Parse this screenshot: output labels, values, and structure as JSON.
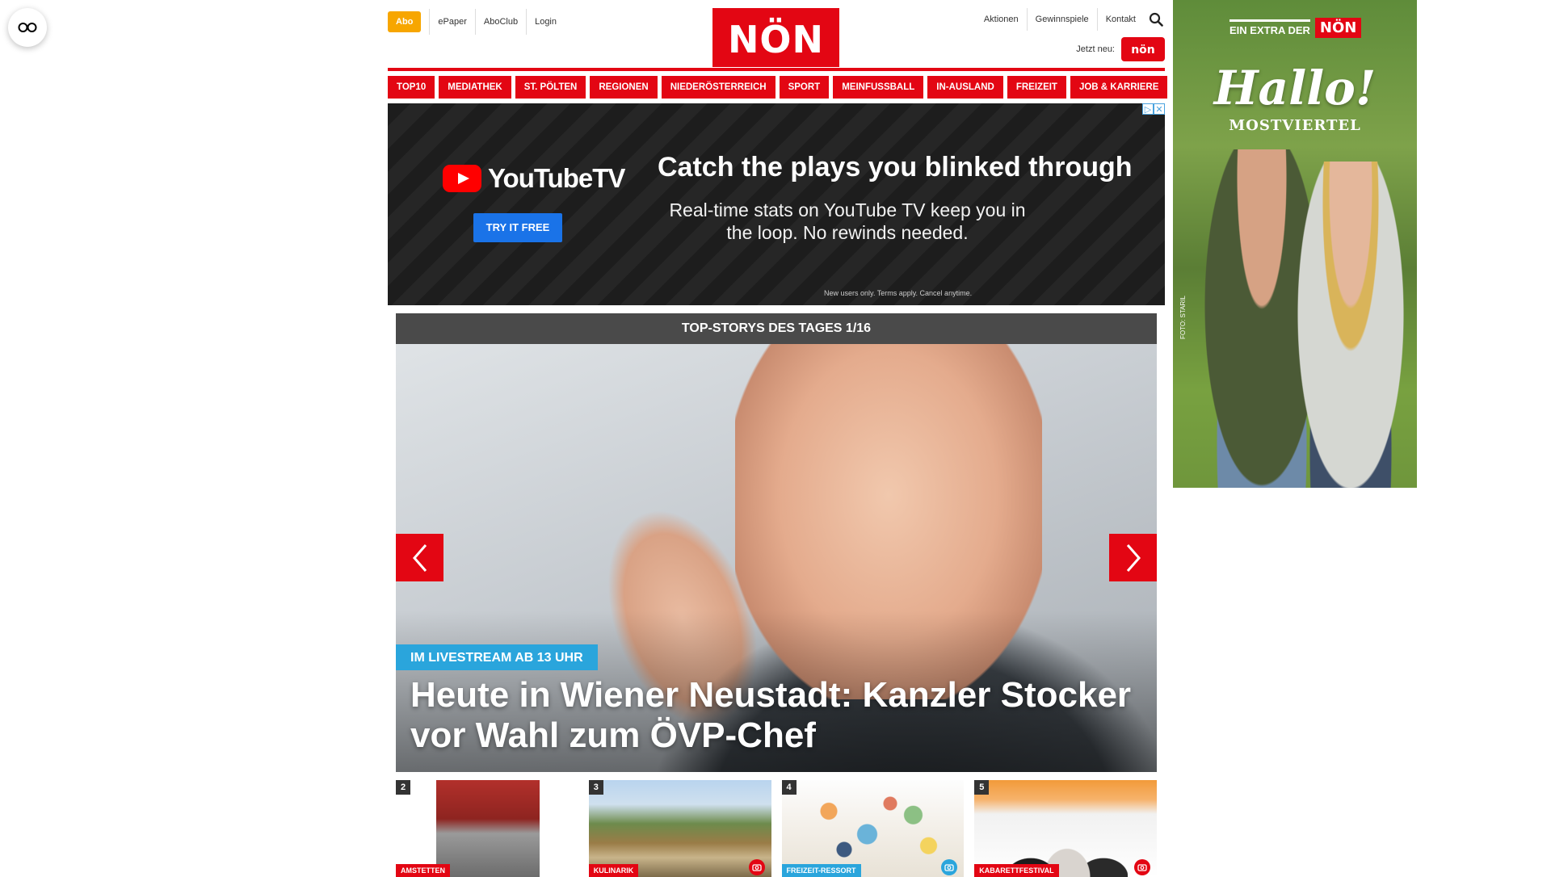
{
  "header": {
    "abo_label": "Abo",
    "links": [
      "ePaper",
      "AboClub",
      "Login"
    ],
    "logo_text": "NÖN",
    "right_links": [
      "Aktionen",
      "Gewinnspiele",
      "Kontakt"
    ],
    "jetzt_label": "Jetzt neu:",
    "jetzt_logo_text": "nön"
  },
  "nav": {
    "items": [
      "TOP10",
      "MEDIATHEK",
      "ST. PÖLTEN",
      "REGIONEN",
      "NIEDERÖSTERREICH",
      "SPORT",
      "MEINFUSSBALL",
      "IN-AUSLAND",
      "FREIZEIT",
      "JOB & KARRIERE"
    ]
  },
  "ad": {
    "brand": "YouTubeTV",
    "cta": "TRY IT FREE",
    "headline": "Catch the plays you blinked through",
    "subline": "Real-time stats on YouTube TV keep you in the loop. No rewinds needed.",
    "fine_print": "New users only. Terms apply. Cancel anytime."
  },
  "stories": {
    "header": "TOP-STORYS DES TAGES 1/16",
    "hero": {
      "tag": "IM LIVESTREAM AB 13 UHR",
      "title": "Heute in Wiener Neustadt: Kanzler Stocker vor Wahl zum ÖVP-Chef"
    },
    "thumbs": [
      {
        "num": "2",
        "category": "AMSTETTEN"
      },
      {
        "num": "3",
        "category": "KULINARIK"
      },
      {
        "num": "4",
        "category": "FREIZEIT-RESSORT"
      },
      {
        "num": "5",
        "category": "KABARETTFESTIVAL"
      }
    ]
  },
  "side_ad": {
    "extra": "EIN EXTRA DER",
    "logo": "NÖN",
    "title": "Hallo!",
    "region": "MOSTVIERTEL",
    "credit": "FOTO: STARIL"
  },
  "colors": {
    "brand_red": "#e30613",
    "abo_orange": "#f7a600",
    "live_blue": "#2aa5dc"
  }
}
